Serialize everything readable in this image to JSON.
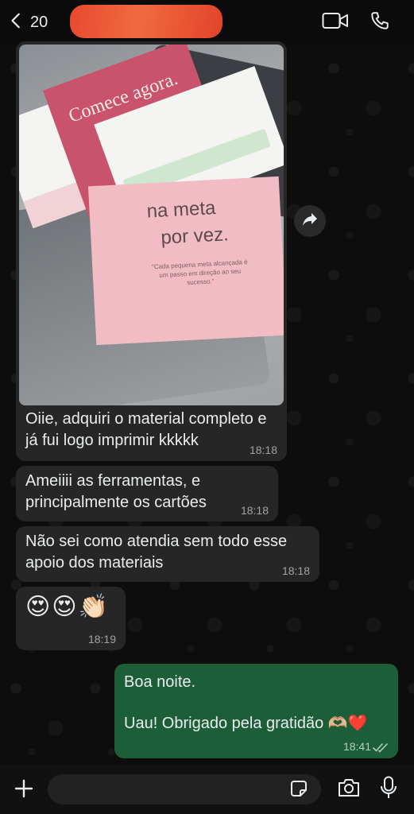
{
  "header": {
    "unread_count": "20",
    "contact_name": "",
    "icons": [
      "chevron-left-icon",
      "video-icon",
      "phone-icon"
    ]
  },
  "messages": [
    {
      "direction": "incoming",
      "type": "image",
      "photo_text": {
        "card_red": "Comece agora.",
        "card_pink_line1": "na meta",
        "card_pink_line2": "por vez.",
        "card_pink_sub": "\"Cada pequena meta alcançada é um passo em direção ao seu sucesso.\""
      },
      "text": "Oiie, adquiri o material completo e já fui logo imprimir kkkkk",
      "time": "18:18"
    },
    {
      "direction": "incoming",
      "text": "Ameiiii as ferramentas, e principalmente os cartões",
      "time": "18:18"
    },
    {
      "direction": "incoming",
      "text": "Não sei como atendia sem todo esse apoio dos materiais",
      "time": "18:18"
    },
    {
      "direction": "incoming",
      "text": "😍😍👏🏻",
      "time": "18:19"
    },
    {
      "direction": "outgoing",
      "line1": "Boa noite.",
      "line2": "Uau! Obrigado pela gratidão 🫶🏼❤️",
      "time": "18:41",
      "status": "read"
    }
  ],
  "composer": {
    "placeholder": "",
    "icons": [
      "plus-icon",
      "sticker-icon",
      "camera-icon",
      "microphone-icon"
    ]
  },
  "colors": {
    "incoming_bubble": "#262626",
    "outgoing_bubble": "#1c5e37",
    "background": "#0b0b0b",
    "redaction": "#e8492e"
  }
}
